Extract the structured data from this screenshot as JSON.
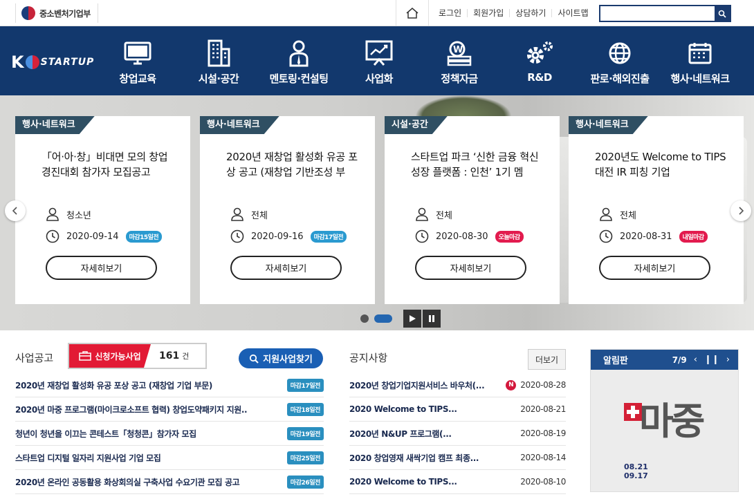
{
  "header": {
    "ministry": "중소벤처기업부",
    "links": [
      "로그인",
      "회원가입",
      "상담하기",
      "사이트맵"
    ],
    "search_placeholder": ""
  },
  "nav": {
    "logo_k": "K",
    "logo_text": "STARTUP",
    "items": [
      {
        "label": "창업교육",
        "icon": "monitor-icon"
      },
      {
        "label": "시설·공간",
        "icon": "building-icon"
      },
      {
        "label": "멘토링·컨설팅",
        "icon": "mentor-icon"
      },
      {
        "label": "사업화",
        "icon": "chart-board-icon"
      },
      {
        "label": "정책자금",
        "icon": "money-icon"
      },
      {
        "label": "R&D",
        "icon": "gears-icon"
      },
      {
        "label": "판로·해외진출",
        "icon": "globe-icon"
      },
      {
        "label": "행사·네트워크",
        "icon": "calendar-icon"
      }
    ]
  },
  "slider": {
    "cards": [
      {
        "category": "행사·네트워크",
        "title": "「어·아·창」비대면 모의 창업경진대회 참가자 모집공고",
        "target": "청소년",
        "date": "2020-09-14",
        "badge": "마감15일전",
        "badge_color": "blue",
        "button": "자세히보기"
      },
      {
        "category": "행사·네트워크",
        "title": "2020년 재창업 활성화 유공 포상 공고 (재창업 기반조성 부",
        "target": "전체",
        "date": "2020-09-16",
        "badge": "마감17일전",
        "badge_color": "blue",
        "button": "자세히보기"
      },
      {
        "category": "시설·공간",
        "title": "스타트업 파크 ‘신한 금융 혁신성장 플랫폼 : 인천’ 1기 멤",
        "target": "전체",
        "date": "2020-08-30",
        "badge": "오늘마감",
        "badge_color": "red",
        "button": "자세히보기"
      },
      {
        "category": "행사·네트워크",
        "title": "2020년도 Welcome to TIPS 대전 IR 피칭 기업",
        "target": "전체",
        "date": "2020-08-31",
        "badge": "내일마감",
        "badge_color": "red",
        "button": "자세히보기"
      }
    ]
  },
  "business": {
    "title": "사업공고",
    "available_label": "신청가능사업",
    "count": "161",
    "unit": "건",
    "find_button": "지원사업찾기",
    "items": [
      {
        "title": "2020년 재창업 활성화 유공 포상 공고 (재창업 기업 부문)",
        "deadline": "마감17일전"
      },
      {
        "title": "2020년 마중 프로그램(마이크로소프트 협력) 창업도약패키지 지원..",
        "deadline": "마감18일전"
      },
      {
        "title": "청년이 청년을 이끄는 콘테스트「청청콘」참가자 모집",
        "deadline": "마감19일전"
      },
      {
        "title": "스타트업 디지털 일자리 지원사업 기업 모집",
        "deadline": "마감25일전"
      },
      {
        "title": "2020년 온라인 공동활용 화상회의실 구축사업 수요기관 모집 공고",
        "deadline": "마감26일전"
      }
    ]
  },
  "notice": {
    "title": "공지사항",
    "more": "더보기",
    "items": [
      {
        "title": "2020년 창업기업지원서비스 바우처(...",
        "date": "2020-08-28",
        "new": "N"
      },
      {
        "title": "2020 Welcome to TIPS...",
        "date": "2020-08-21",
        "new": ""
      },
      {
        "title": "2020년 N&UP 프로그램(...",
        "date": "2020-08-19",
        "new": ""
      },
      {
        "title": "2020 창업영재 새싹기업 캠프 최종...",
        "date": "2020-08-14",
        "new": ""
      },
      {
        "title": "2020 Welcome to TIPS...",
        "date": "2020-08-10",
        "new": ""
      }
    ]
  },
  "alarm": {
    "title": "알림판",
    "page": "7/9",
    "poster_title": "마중",
    "poster_date1": "08.21",
    "poster_date2": "09.17"
  }
}
